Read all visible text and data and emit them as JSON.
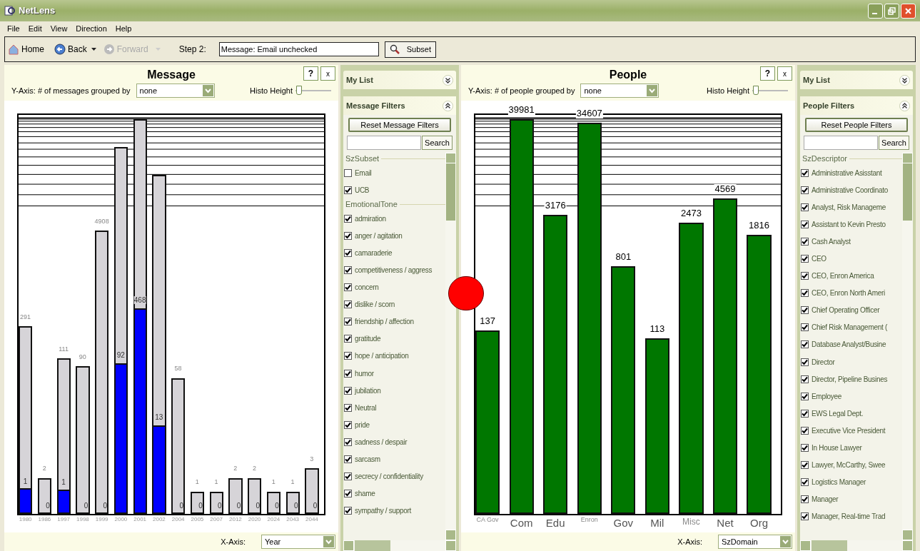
{
  "window": {
    "title": "NetLens"
  },
  "menu": [
    "File",
    "Edit",
    "View",
    "Direction",
    "Help"
  ],
  "toolbar": {
    "home": "Home",
    "back": "Back",
    "forward": {
      "label": "Forward",
      "disabled": true
    },
    "step_label": "Step 2:",
    "step_value": "Message: Email unchecked",
    "subset": "Subset"
  },
  "panels": [
    {
      "title": "Message",
      "help": "?",
      "close": "x",
      "y_axis_label": "Y-Axis: # of messages grouped by",
      "y_axis_value": "none",
      "histo_label": "Histo Height",
      "histo": {
        "level": 0.02
      },
      "x_axis_label": "X-Axis:",
      "x_axis_value": "Year",
      "kind": "split",
      "bars": [
        {
          "category": "1980",
          "total": "291",
          "count": "1",
          "fill": {
            "level": 0.13
          }
        },
        {
          "category": "1986",
          "total": "2",
          "count": "0"
        },
        {
          "category": "1997",
          "total": "111",
          "count": "1",
          "fill": {
            "level": 0.15
          }
        },
        {
          "category": "1998",
          "total": "90",
          "count": "0"
        },
        {
          "category": "1999",
          "total": "4908",
          "count": "0"
        },
        {
          "category": "2000",
          "count": "92",
          "fill": {
            "level": 0.41
          }
        },
        {
          "category": "2001",
          "count": "468",
          "fill": {
            "level": 0.52
          }
        },
        {
          "category": "2002",
          "count": "13",
          "fill": {
            "level": 0.26
          }
        },
        {
          "category": "2004",
          "total": "58",
          "count": "0"
        },
        {
          "category": "2005",
          "total": "1",
          "count": "0"
        },
        {
          "category": "2007",
          "total": "1",
          "count": "0"
        },
        {
          "category": "2012",
          "total": "2",
          "count": "0"
        },
        {
          "category": "2020",
          "total": "2",
          "count": "0"
        },
        {
          "category": "2024",
          "total": "1",
          "count": "0"
        },
        {
          "category": "2043",
          "total": "1",
          "count": "0"
        },
        {
          "category": "2044",
          "total": "3",
          "count": "0"
        }
      ],
      "filters": {
        "my_list": "My List",
        "title": "Message Filters",
        "reset": "Reset Message Filters",
        "search": "Search",
        "groups": [
          {
            "name": "SzSubset",
            "items": [
              {
                "label": "Email",
                "checked": false
              },
              {
                "label": "UCB",
                "checked": true
              }
            ]
          },
          {
            "name": "EmotionalTone",
            "items": [
              {
                "label": "admiration",
                "checked": true
              },
              {
                "label": "anger / agitation",
                "checked": true
              },
              {
                "label": "camaraderie",
                "checked": true
              },
              {
                "label": "competitiveness / aggress",
                "checked": true
              },
              {
                "label": "concern",
                "checked": true
              },
              {
                "label": "dislike / scorn",
                "checked": true
              },
              {
                "label": "friendship / affection",
                "checked": true
              },
              {
                "label": "gratitude",
                "checked": true
              },
              {
                "label": "hope / anticipation",
                "checked": true
              },
              {
                "label": "humor",
                "checked": true
              },
              {
                "label": "jubilation",
                "checked": true
              },
              {
                "label": "Neutral",
                "checked": true
              },
              {
                "label": "pride",
                "checked": true
              },
              {
                "label": "sadness / despair",
                "checked": true
              },
              {
                "label": "sarcasm",
                "checked": true
              },
              {
                "label": "secrecy / confidentiality",
                "checked": true
              },
              {
                "label": "shame",
                "checked": true
              },
              {
                "label": "sympathy / support",
                "checked": true
              }
            ]
          }
        ]
      }
    },
    {
      "title": "People",
      "help": "?",
      "close": "x",
      "y_axis_label": "Y-Axis: # of people grouped by",
      "y_axis_value": "none",
      "histo_label": "Histo Height",
      "histo": {
        "level": 0.02
      },
      "x_axis_label": "X-Axis:",
      "x_axis_value": "SzDomain",
      "kind": "plain",
      "bars": [
        {
          "category": "CA Gov",
          "total": "137"
        },
        {
          "category": "Com",
          "total": "39981"
        },
        {
          "category": "Edu",
          "total": "3176"
        },
        {
          "category": "Enron",
          "total": "34607"
        },
        {
          "category": "Gov",
          "total": "801"
        },
        {
          "category": "Mil",
          "total": "113"
        },
        {
          "category": "Misc",
          "total": "2473"
        },
        {
          "category": "Net",
          "total": "4569"
        },
        {
          "category": "Org",
          "total": "1816"
        }
      ],
      "filters": {
        "my_list": "My List",
        "title": "People Filters",
        "reset": "Reset People Filters",
        "search": "Search",
        "groups": [
          {
            "name": "SzDescriptor",
            "items": [
              {
                "label": "Administrative Asisstant",
                "checked": true
              },
              {
                "label": "Administrative  Coordinato",
                "checked": true
              },
              {
                "label": "Analyst, Risk Manageme",
                "checked": true
              },
              {
                "label": "Assistant to Kevin Presto",
                "checked": true
              },
              {
                "label": "Cash Analyst",
                "checked": true
              },
              {
                "label": "CEO",
                "checked": true
              },
              {
                "label": "CEO, Enron America",
                "checked": true
              },
              {
                "label": "CEO, Enron North Ameri",
                "checked": true
              },
              {
                "label": "Chief Operating Officer",
                "checked": true
              },
              {
                "label": "Chief Risk Management (",
                "checked": true
              },
              {
                "label": "Database Analyst/Busine",
                "checked": true
              },
              {
                "label": "Director",
                "checked": true
              },
              {
                "label": "Director, Pipeline Busines",
                "checked": true
              },
              {
                "label": "Employee",
                "checked": true
              },
              {
                "label": "EWS Legal Dept.",
                "checked": true
              },
              {
                "label": "Executive Vice President",
                "checked": true
              },
              {
                "label": "In House Lawyer",
                "checked": true
              },
              {
                "label": "Lawyer, McCarthy,  Swee",
                "checked": true
              },
              {
                "label": "Logistics Manager",
                "checked": true
              },
              {
                "label": "Manager",
                "checked": true
              },
              {
                "label": "Manager, Real-time Trad",
                "checked": true
              }
            ]
          }
        ]
      }
    }
  ]
}
